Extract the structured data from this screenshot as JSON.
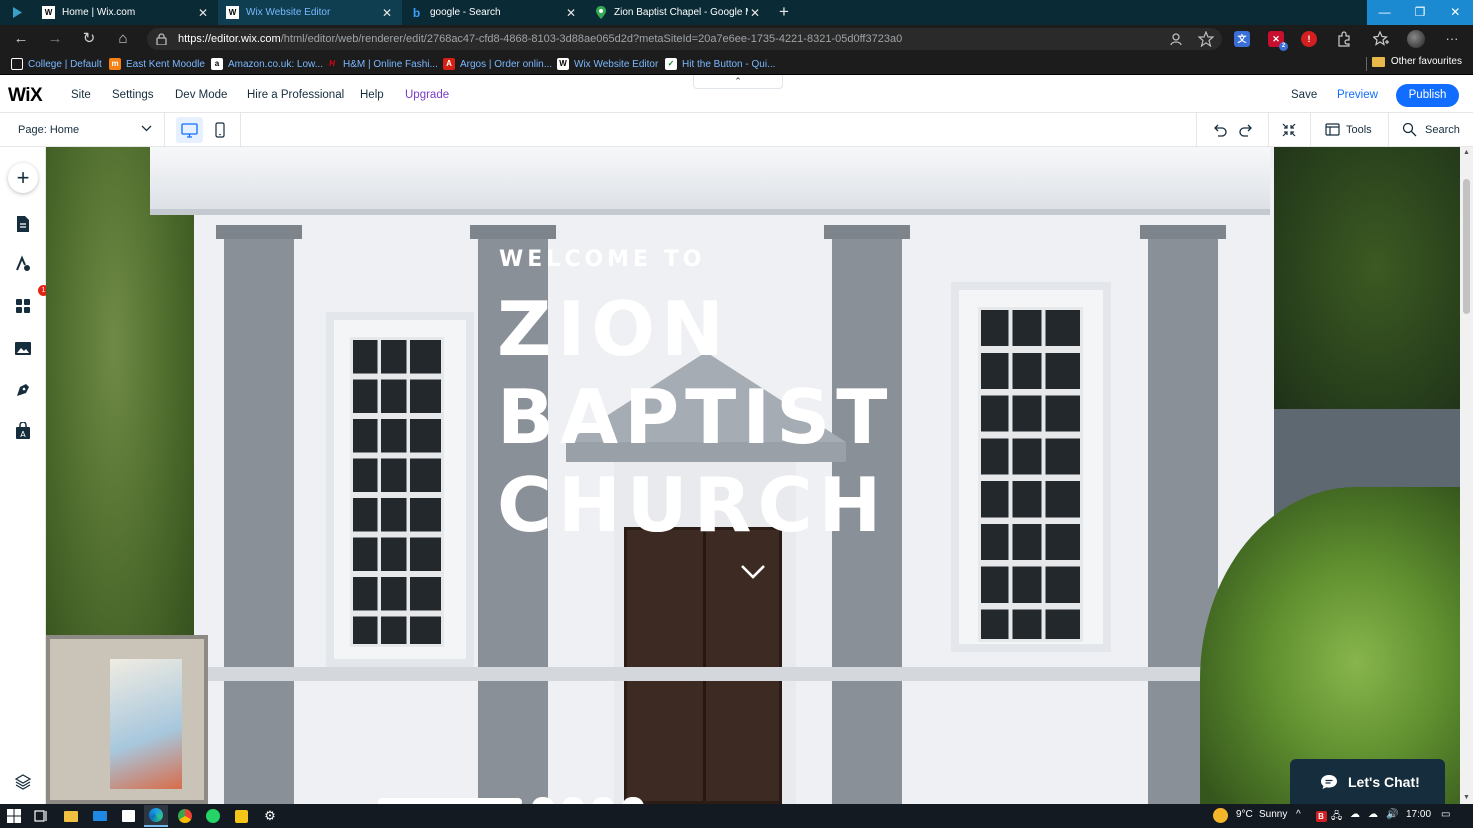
{
  "browser": {
    "tabs": [
      {
        "title": "Home | Wix.com",
        "favicon": "wix-favicon",
        "active": false
      },
      {
        "title": "Wix Website Editor",
        "favicon": "wix-favicon",
        "active": true
      },
      {
        "title": "google - Search",
        "favicon": "bing-favicon",
        "active": false
      },
      {
        "title": "Zion Baptist Chapel - Google M...",
        "favicon": "maps-pin-favicon",
        "active": false
      }
    ],
    "new_tab": "+",
    "url_host": "https://editor.wix.com",
    "url_path": "/html/editor/web/renderer/edit/2768ac47-cfd8-4868-8103-3d88ae065d2d?metaSiteId=20a7e6ee-1735-4221-8321-05d0ff3723a0",
    "bookmarks": [
      {
        "label": "College | Default",
        "icon": "page-icon",
        "color": "#ffffff"
      },
      {
        "label": "East Kent Moodle",
        "icon": "moodle-icon",
        "color": "#f98012"
      },
      {
        "label": "Amazon.co.uk: Low...",
        "icon": "amazon-icon",
        "color": "#ffffff"
      },
      {
        "label": "H&M | Online Fashi...",
        "icon": "hm-icon",
        "color": "#e50010"
      },
      {
        "label": "Argos | Order onlin...",
        "icon": "argos-icon",
        "color": "#d42114"
      },
      {
        "label": "Wix Website Editor",
        "icon": "wix-icon",
        "color": "#ffffff"
      },
      {
        "label": "Hit the Button - Qui...",
        "icon": "check-icon",
        "color": "#ffffff"
      }
    ],
    "other_favourites": "Other favourites",
    "ext_badge": "2"
  },
  "wix": {
    "logo": "WiX",
    "menu": [
      "Site",
      "Settings",
      "Dev Mode",
      "Hire a Professional",
      "Help",
      "Upgrade"
    ],
    "save": "Save",
    "preview": "Preview",
    "publish": "Publish",
    "page_label": "Page:",
    "page_value": "Home",
    "tools": "Tools",
    "search": "Search",
    "apps_badge": "1",
    "accent": "#116dff"
  },
  "site": {
    "welcome": "WELCOME TO",
    "title_lines": [
      "ZION",
      "BAPTIST",
      "CHURCH"
    ],
    "chat": "Let's Chat!"
  },
  "taskbar": {
    "temperature": "9°C",
    "weather": "Sunny",
    "time": "17:00"
  }
}
